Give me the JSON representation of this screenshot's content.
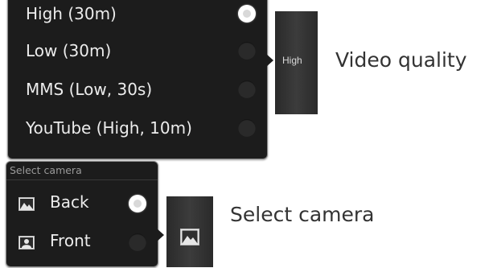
{
  "quality_menu": {
    "items": [
      {
        "label": "High (30m)",
        "selected": true
      },
      {
        "label": "Low (30m)",
        "selected": false
      },
      {
        "label": "MMS (Low, 30s)",
        "selected": false
      },
      {
        "label": "YouTube (High, 10m)",
        "selected": false
      }
    ]
  },
  "quality_button": {
    "label": "High"
  },
  "quality_callout": "Video quality",
  "camera_menu": {
    "header": "Select camera",
    "items": [
      {
        "label": "Back",
        "icon": "landscape-photo-icon",
        "selected": true
      },
      {
        "label": "Front",
        "icon": "portrait-icon",
        "selected": false
      }
    ]
  },
  "camera_button": {
    "icon": "landscape-photo-icon"
  },
  "camera_callout": "Select camera"
}
